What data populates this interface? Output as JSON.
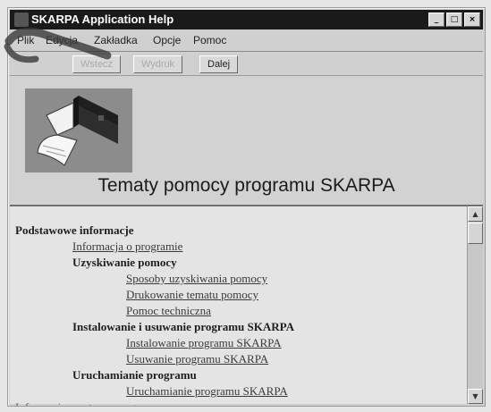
{
  "window": {
    "title": "SKARPA Application Help",
    "min_glyph": "_",
    "max_glyph": "□",
    "close_glyph": "×"
  },
  "menu": {
    "items": [
      "Plik",
      "Edycja",
      "Zakładka",
      "Opcje",
      "Pomoc"
    ]
  },
  "toolbar": {
    "buttons": [
      "Wstecz",
      "Wydruk",
      "Dalej"
    ]
  },
  "header": {
    "title": "Tematy pomocy programu SKARPA"
  },
  "content": {
    "main_heading": "Podstawowe informacje",
    "link_program_info": "Informacja o programie",
    "getting_help_heading": "Uzyskiwanie pomocy",
    "link_ways_of_help": "Sposoby uzyskiwania pomocy",
    "link_print_topic": "Drukowanie tematu pomocy",
    "link_tech_support": "Pomoc techniczna",
    "install_heading": "Instalowanie i usuwanie programu SKARPA",
    "link_install": "Instalowanie programu SKARPA",
    "link_remove": "Usuwanie programu SKARPA",
    "launch_heading": "Uruchamianie programu",
    "link_launch": "Uruchamianie programu SKARPA",
    "last_line": "Informacja o autorze programu"
  },
  "scrollbar": {
    "up_glyph": "▲",
    "down_glyph": "▼"
  },
  "colors": {
    "titlebar": "#1a1a1a",
    "window": "#d0d0d0",
    "content": "#e4e4e4",
    "annotation_stroke": "#3a3a3a"
  }
}
